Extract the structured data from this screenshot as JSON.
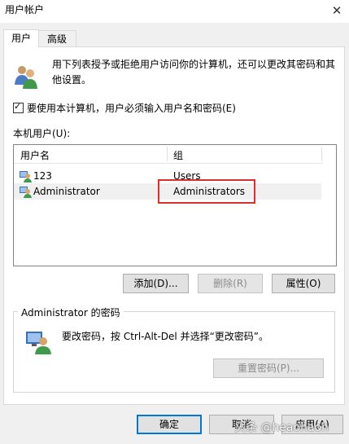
{
  "window": {
    "title": "用户帐户",
    "close_glyph": "✕"
  },
  "tabs": [
    {
      "label": "用户",
      "active": true
    },
    {
      "label": "高级",
      "active": false
    }
  ],
  "info": {
    "text": "用下列表授予或拒绝用户访问你的计算机，还可以更改其密码和其他设置。"
  },
  "require_login": {
    "checked": true,
    "label": "要使用本计算机，用户必须输入用户名和密码(E)"
  },
  "users_list": {
    "label": "本机用户(U):",
    "columns": {
      "name": "用户名",
      "group": "组"
    },
    "rows": [
      {
        "name": "123",
        "group": "Users",
        "selected": false
      },
      {
        "name": "Administrator",
        "group": "Administrators",
        "selected": true
      }
    ]
  },
  "list_buttons": {
    "add": "添加(D)...",
    "remove": "删除(R)",
    "properties": "属性(O)"
  },
  "password_group": {
    "title": "Administrator 的密码",
    "text": "要改密码，按 Ctrl-Alt-Del 并选择“更改密码”。",
    "reset_button": "重置密码(P)..."
  },
  "dialog_buttons": {
    "ok": "确定",
    "cancel": "取消",
    "apply": "应用(A)"
  },
  "watermark": "头条 @heaohaoh",
  "colors": {
    "accent": "#0078d7",
    "highlight_border": "#d9302f"
  }
}
